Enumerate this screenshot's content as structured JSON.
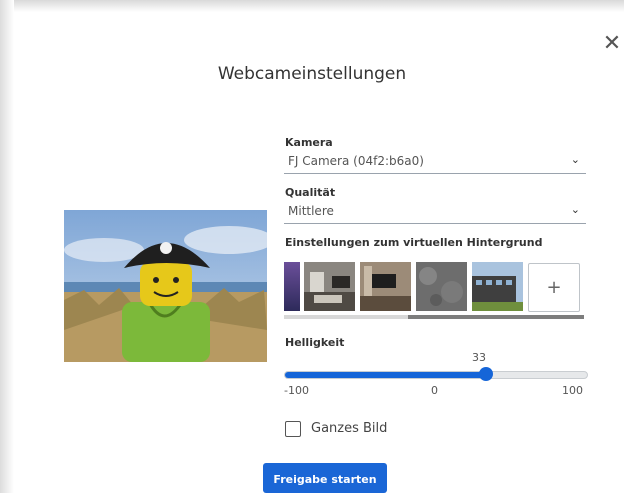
{
  "dialog": {
    "title": "Webcameinstellungen",
    "close_glyph": "✕"
  },
  "camera": {
    "label": "Kamera",
    "value": "FJ Camera (04f2:b6a0)"
  },
  "quality": {
    "label": "Qualität",
    "value": "Mittlere"
  },
  "virtual_background": {
    "label": "Einstellungen zum virtuellen Hintergrund",
    "add_glyph": "+",
    "thumbnails": [
      "purple-gradient",
      "living-room",
      "tv-room",
      "gray-texture",
      "building-exterior"
    ]
  },
  "brightness": {
    "label": "Helligkeit",
    "value": 33,
    "value_text": "33",
    "min": -100,
    "max": 100,
    "ticks": [
      "-100",
      "0",
      "100"
    ]
  },
  "full_image": {
    "label": "Ganzes Bild",
    "checked": false
  },
  "actions": {
    "start_label": "Freigabe starten"
  },
  "colors": {
    "accent": "#1565d8",
    "button": "#1a66d6"
  }
}
